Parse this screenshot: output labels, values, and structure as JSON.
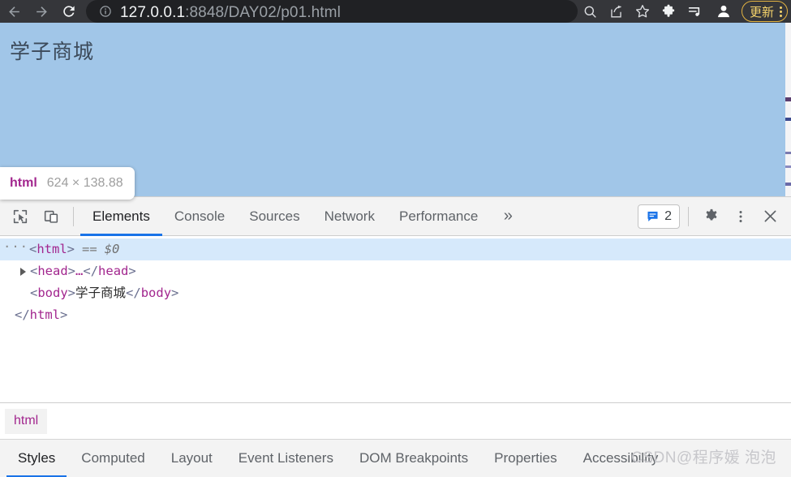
{
  "browser": {
    "nav": {
      "back_icon": "arrow-left-icon",
      "forward_icon": "arrow-right-icon",
      "reload_icon": "reload-icon"
    },
    "omnibox": {
      "site_info_icon": "info-circle-icon",
      "url_host": "127.0.0.1",
      "url_rest": ":8848/DAY02/p01.html",
      "url_full": "127.0.0.1:8848/DAY02/p01.html"
    },
    "toolbar_icons": [
      "zoom-search-icon",
      "share-icon",
      "star-bookmark-icon",
      "extensions-puzzle-icon",
      "reading-list-icon",
      "profile-avatar-icon"
    ],
    "update_button": {
      "label": "更新",
      "menu_icon": "three-dots-vertical-icon",
      "accent": "#e3b341"
    }
  },
  "page": {
    "heading": "学子商城",
    "highlight_color": "#a1c6e8"
  },
  "inspect_tooltip": {
    "tag": "html",
    "dimensions": "624 × 138.88",
    "tag_color": "#a2268e"
  },
  "devtools": {
    "left_icons": [
      "inspect-element-icon",
      "device-toolbar-icon"
    ],
    "tabs": [
      {
        "label": "Elements",
        "active": true
      },
      {
        "label": "Console",
        "active": false
      },
      {
        "label": "Sources",
        "active": false
      },
      {
        "label": "Network",
        "active": false
      },
      {
        "label": "Performance",
        "active": false
      }
    ],
    "overflow_label": "»",
    "issues": {
      "icon": "issues-message-icon",
      "count": "2",
      "color": "#1a73e8"
    },
    "right_icons": [
      "settings-gear-icon",
      "more-options-icon",
      "close-icon"
    ],
    "dom_tree": {
      "rows": [
        {
          "ellipsis": "···",
          "open": "<html>",
          "suffix_eq": "==",
          "suffix_var": "$0",
          "selected": true
        },
        {
          "open": "<head>",
          "collapsed_dots": "…",
          "close": "</head>",
          "has_triangle": true
        },
        {
          "open": "<body>",
          "text": "学子商城 ",
          "close": "</body>"
        },
        {
          "close_only": "</html>"
        }
      ],
      "tag_color": "#a2268e",
      "selected_row_bg": "#d6e9fb"
    },
    "breadcrumb": [
      "html"
    ],
    "sidebar_tabs": [
      {
        "label": "Styles",
        "active": true
      },
      {
        "label": "Computed",
        "active": false
      },
      {
        "label": "Layout",
        "active": false
      },
      {
        "label": "Event Listeners",
        "active": false
      },
      {
        "label": "DOM Breakpoints",
        "active": false
      },
      {
        "label": "Properties",
        "active": false
      },
      {
        "label": "Accessibility",
        "active": false
      }
    ]
  },
  "watermark": {
    "text": "CSDN@程序媛 泡泡"
  }
}
